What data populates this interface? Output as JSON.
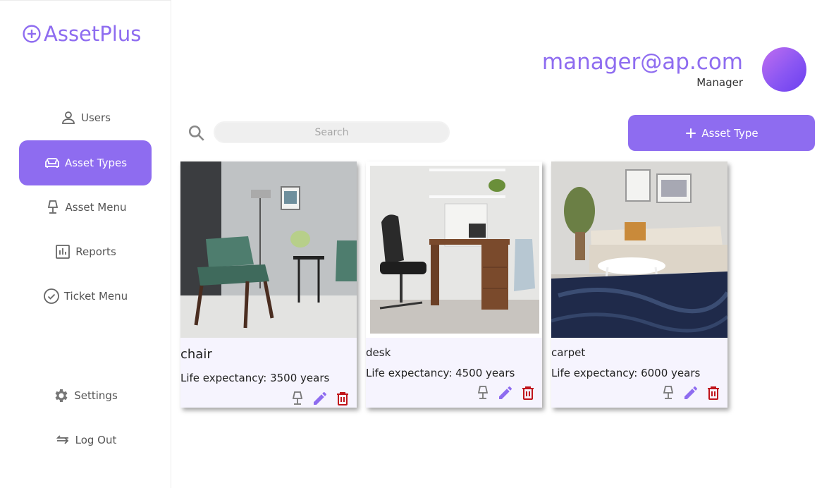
{
  "app": {
    "title": "AssetPlus"
  },
  "colors": {
    "accent": "#8e6cf0",
    "delete": "#c0141b",
    "icon_gray": "#777777"
  },
  "sidebar": {
    "items": [
      {
        "label": "Users",
        "icon": "user-icon"
      },
      {
        "label": "Asset Types",
        "icon": "sofa-icon",
        "active": true
      },
      {
        "label": "Asset Menu",
        "icon": "lamp-icon"
      },
      {
        "label": "Reports",
        "icon": "bar-chart-icon"
      },
      {
        "label": "Ticket Menu",
        "icon": "check-circle-icon"
      }
    ],
    "bottom": [
      {
        "label": "Settings",
        "icon": "gear-icon"
      },
      {
        "label": "Log Out",
        "icon": "logout-icon"
      }
    ]
  },
  "header": {
    "email": "manager@ap.com",
    "role": "Manager"
  },
  "search": {
    "placeholder": "Search"
  },
  "add_button": {
    "label": "Asset Type"
  },
  "assets": [
    {
      "name": "chair",
      "life": "Life expectancy: 3500 years"
    },
    {
      "name": "desk",
      "life": "Life expectancy: 4500 years"
    },
    {
      "name": "carpet",
      "life": "Life expectancy: 6000 years"
    }
  ]
}
